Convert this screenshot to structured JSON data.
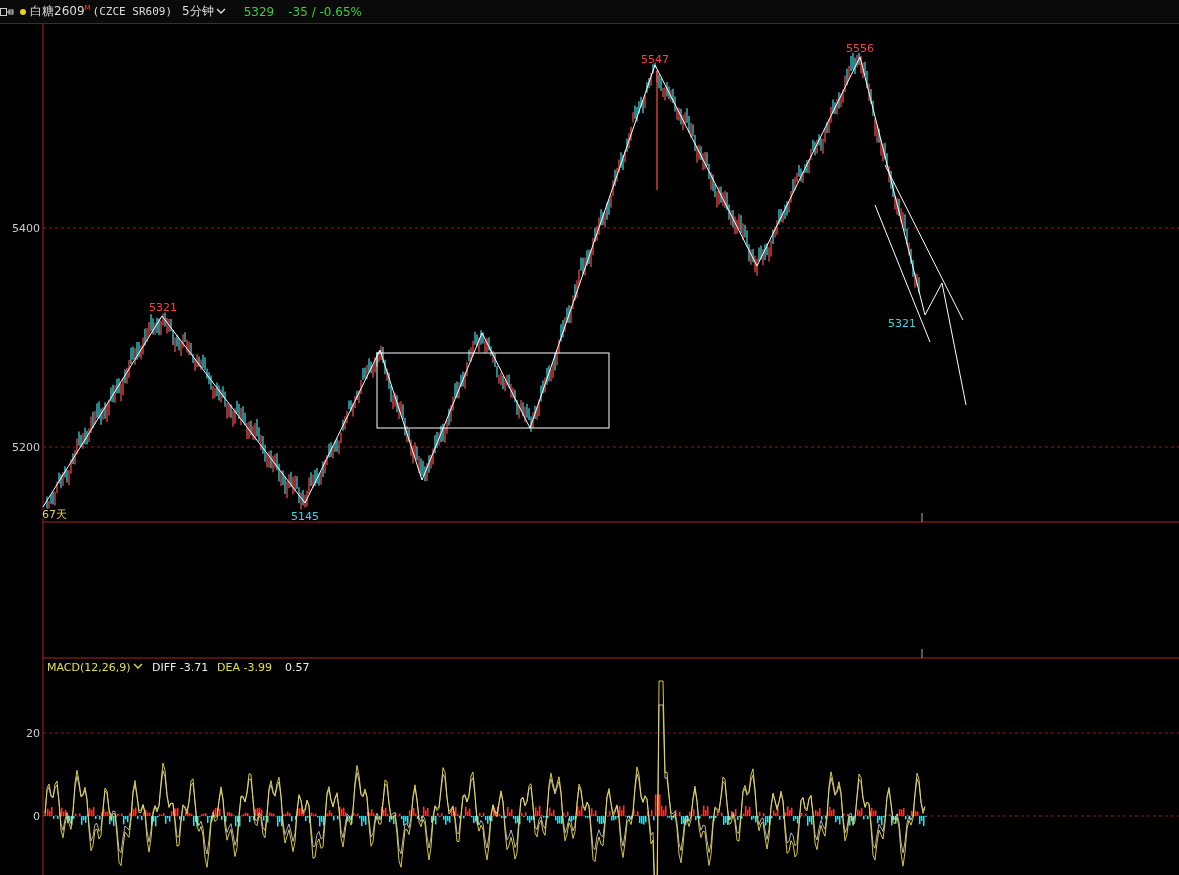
{
  "header": {
    "symbol": "白糖2609",
    "symbol_mark": "M",
    "code": "(CZCE SR609)",
    "period": "5分钟",
    "last_price": "5329",
    "change": "-35 / -0.65%"
  },
  "price_pane": {
    "yticks": [
      "5400",
      "5200"
    ],
    "span_label": "67天",
    "annotations": [
      {
        "label": "5321",
        "kind": "peak"
      },
      {
        "label": "5145",
        "kind": "trough"
      },
      {
        "label": "5547",
        "kind": "peak"
      },
      {
        "label": "5556",
        "kind": "peak"
      },
      {
        "label": "5321",
        "kind": "trough"
      }
    ]
  },
  "macd_pane": {
    "indicator": "MACD(12,26,9)",
    "diff": "DIFF -3.71",
    "dea": "DEA -3.99",
    "macd": "0.57",
    "yticks": [
      "20",
      "0"
    ]
  }
}
